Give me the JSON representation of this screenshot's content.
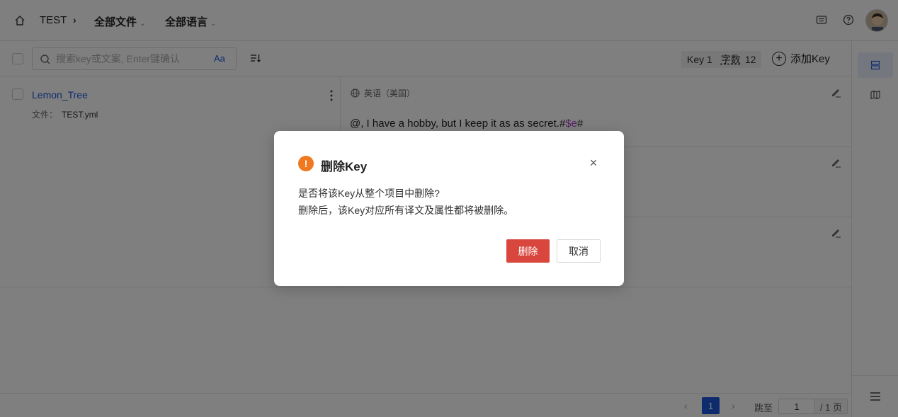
{
  "header": {
    "project_name": "TEST",
    "file_filter": "全部文件",
    "lang_filter": "全部语言"
  },
  "toolbar": {
    "search_placeholder": "搜索key或文案, Enter键确认",
    "case_toggle": "Aa",
    "key_count": "Key 1",
    "word_count_label": "字数",
    "word_count": "12",
    "add_key": "添加Key"
  },
  "keys": [
    {
      "name": "Lemon_Tree",
      "file_label": "文件：",
      "file": "TEST.yml"
    }
  ],
  "translations": [
    {
      "lang": "英语（美国）",
      "text_prefix": "@, I have a hobby, but I keep it as as secret.#",
      "text_var": "$e",
      "text_suffix": "#"
    }
  ],
  "pagination": {
    "prev": "‹",
    "current": "1",
    "next": "›",
    "jump_label": "跳至",
    "jump_value": "1",
    "total": "/ 1 页"
  },
  "dialog": {
    "title": "删除Key",
    "message_line1": "是否将该Key从整个项目中删除?",
    "message_line2": "删除后，该Key对应所有译文及属性都将被删除。",
    "confirm": "删除",
    "cancel": "取消",
    "warn_glyph": "!",
    "close_glyph": "×"
  },
  "colors": {
    "accent": "#1a56db",
    "danger": "#d9463e",
    "warning": "#f0781e",
    "variable": "#b041c8"
  }
}
